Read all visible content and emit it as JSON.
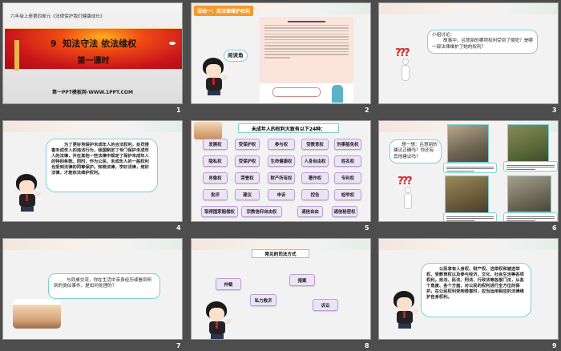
{
  "slides": [
    {
      "number": "1",
      "unit": "六年级上册第四单元《法律保护我们健康成长》",
      "title": "9  知法守法 依法维权",
      "subtitle": "第一课时",
      "site": "第一PPT模板网-WWW.1PPT.COM"
    },
    {
      "number": "2",
      "activity": "活动一：用法律维护权利",
      "reading_label": "阅读角"
    },
    {
      "number": "3",
      "question": "小组讨论：",
      "question_body": "故事中，吕慧丽的哪项权利受到了侵犯？是哪一部法律维护了她的权利？"
    },
    {
      "number": "4",
      "text": "为了更好地保护未成年人的合法权利，处罚侵害未成年人的违法行为，我国制定了专门保护未成年人的法律，并在其他一些法律中规定了保护未成年人的特别条款。同时，作为公民，未成年人的一般权利也受到法律的同等保护。知晓法律，学好法律，用好法律，才能依法维护权利。"
    },
    {
      "number": "5",
      "title": "未成年人的权利大致有以下24种：",
      "rights": [
        "发展权",
        "受保护权",
        "参与权",
        "受教育权",
        "刑事豁免权",
        "隐私权",
        "受保护权",
        "生命健康权",
        "人身自由权",
        "姓名权",
        "肖像权",
        "荣誉权",
        "财产所有权",
        "著作权",
        "专利权",
        "批评",
        "建议",
        "申诉",
        "控告",
        "检举权",
        "取得国家赔偿权",
        "宗教信仰自由权",
        "通信自由",
        "通信秘密权"
      ]
    },
    {
      "number": "6",
      "question": "想一想：吕慧丽的建议正确吗？你还有其他建议吗？"
    },
    {
      "number": "7",
      "text": "与同桌交流，你在生活中亲身经历或看到听到的类似事件，是如何处理的？"
    },
    {
      "number": "8",
      "title": "常见的司法方式",
      "methods": [
        "仲裁",
        "报案",
        "私力救济",
        "诉讼"
      ]
    },
    {
      "number": "9",
      "text": "公民享有人身权、财产权、选举权和被选举权、受教育权以及参与经济、文化、社会生活等各项权利。宪法、民法、刑法、行政法等各部门法，从各个角度、各个方面，对公民的权利进行全方位的保护。在公民权利受到侵害时，应当运用相应的法律维护自身权利。"
    }
  ],
  "colors": {
    "background": "#4d4d4d",
    "accent": "#7fd0d0",
    "tag": "#ece4f6",
    "banner": "#d8281c"
  }
}
